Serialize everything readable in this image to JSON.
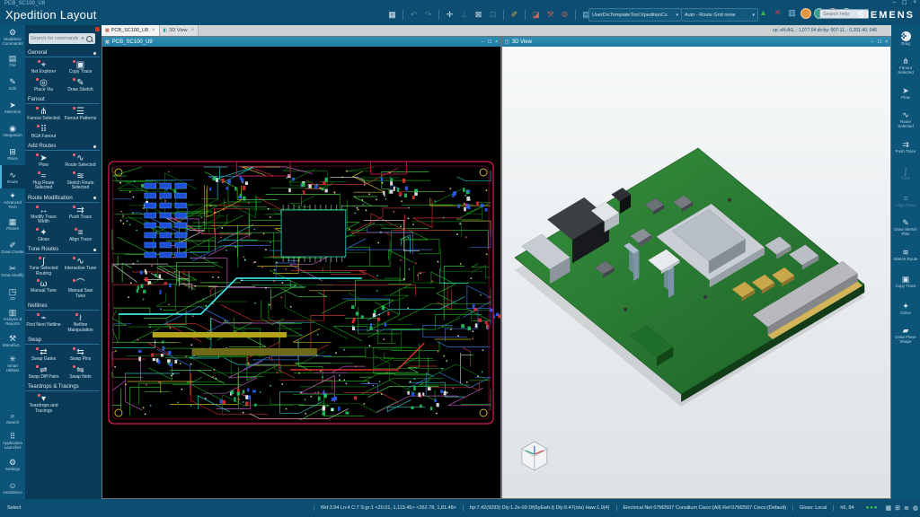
{
  "colors": {
    "titlebar_bg": "#0b4e71",
    "panel_bg": "#0a3c59",
    "window_titlebar": "#2786ad",
    "board_outline": "#d4145a",
    "board_green": "#2e8134",
    "canvas_bg": "#000000",
    "status_dot_green": "#39d353"
  },
  "titlebar": {
    "window_caption": "PCB_SC100_U8",
    "app_title": "Xpedition Layout",
    "brand": "SIEMENS",
    "search_placeholder": "Search help",
    "minimize_label": "–",
    "maximize_label": "☐",
    "close_label": "×"
  },
  "toolbar": {
    "dropdown_template": "UserDrcTemplateTool:XpeditionCs",
    "dropdown_route": "Auto - Route Grid none",
    "readout": "vp: eN:AG, : 1,077.04    drcby: 007-11, : 0,201.40,  046",
    "items": [
      {
        "name": "design-status-icon"
      },
      {
        "name": "separator"
      },
      {
        "name": "undo-icon",
        "disabled": true
      },
      {
        "name": "redo-icon",
        "disabled": true
      },
      {
        "name": "separator"
      },
      {
        "name": "pin-icon"
      },
      {
        "name": "align-icon",
        "disabled": true
      },
      {
        "name": "lock-icon"
      },
      {
        "name": "unlock-icon",
        "disabled": true
      },
      {
        "name": "separator"
      },
      {
        "name": "measure-icon",
        "accent": "#e8a33d"
      },
      {
        "name": "separator"
      },
      {
        "name": "eraser-icon",
        "accent": "#c56a5a"
      },
      {
        "name": "hammer-icon",
        "accent": "#b85c4e"
      },
      {
        "name": "wrench-icon",
        "accent": "#b85c4e"
      },
      {
        "name": "separator"
      },
      {
        "name": "scheme-icon",
        "accent": "#8fc3dd"
      }
    ],
    "right_items": [
      {
        "name": "check-icon",
        "accent": "#3fae5a"
      },
      {
        "name": "cross-icon",
        "accent": "#c74040"
      },
      {
        "name": "report-icon",
        "accent": "#8fc3dd"
      }
    ],
    "circles": [
      {
        "name": "status-orange-icon",
        "color": "#e2973f"
      },
      {
        "name": "status-teal-icon",
        "color": "#2f9f8f"
      },
      {
        "name": "status-red-icon",
        "color": "#c74040"
      },
      {
        "name": "status-green-icon",
        "color": "#3fae5a"
      }
    ]
  },
  "tabs": [
    {
      "label": "PCB_SC100_U8",
      "active": true,
      "icon": "pcb-tab-icon"
    },
    {
      "label": "3D View",
      "active": false,
      "icon": "cube-tab-icon"
    }
  ],
  "left_rail": {
    "items": [
      {
        "label": "Modeless Commands",
        "icon": "modeless-commands-icon"
      },
      {
        "label": "File",
        "icon": "file-icon"
      },
      {
        "label": "Edit",
        "icon": "edit-icon"
      },
      {
        "label": "Selection",
        "icon": "selection-icon"
      },
      {
        "label": "Integration",
        "icon": "integration-icon"
      },
      {
        "label": "Place",
        "icon": "place-icon"
      },
      {
        "label": "Route",
        "icon": "route-icon",
        "selected": true
      },
      {
        "label": "Advanced Tech",
        "icon": "advanced-tech-icon"
      },
      {
        "label": "Planes",
        "icon": "planes-icon"
      },
      {
        "label": "Draw Create",
        "icon": "draw-create-icon"
      },
      {
        "label": "Draw Modify",
        "icon": "draw-modify-icon"
      },
      {
        "label": "3D",
        "icon": "3d-icon"
      },
      {
        "label": "Analysis & Reports",
        "icon": "analysis-reports-icon"
      },
      {
        "label": "Manufact...",
        "icon": "manufacturing-icon"
      },
      {
        "label": "Smart Utilities",
        "icon": "smart-utilities-icon"
      }
    ],
    "bottom_items": [
      {
        "label": "Search",
        "icon": "search-icon"
      },
      {
        "label": "Application Launcher",
        "icon": "application-launcher-icon"
      },
      {
        "label": "Settings",
        "icon": "settings-icon"
      },
      {
        "label": "Assistance",
        "icon": "assistance-icon"
      }
    ]
  },
  "panel": {
    "search_placeholder": "Search for commands",
    "sections": [
      {
        "title": "General",
        "pinned": true,
        "items": [
          {
            "label": "Net Explorer",
            "icon": "net-explorer-icon"
          },
          {
            "label": "Copy Trace",
            "icon": "copy-trace-icon"
          },
          {
            "label": "Place Via",
            "icon": "place-via-icon"
          },
          {
            "label": "Draw Sketch",
            "icon": "draw-sketch-icon"
          }
        ]
      },
      {
        "title": "Fanout",
        "pinned": false,
        "items": [
          {
            "label": "Fanout Selected",
            "icon": "fanout-selected-icon"
          },
          {
            "label": "Fanout Patterns",
            "icon": "fanout-patterns-icon"
          },
          {
            "label": "BGA Fanout",
            "icon": "bga-fanout-icon"
          }
        ]
      },
      {
        "title": "Add Routes",
        "pinned": true,
        "items": [
          {
            "label": "Plow",
            "icon": "plow-icon"
          },
          {
            "label": "Route Selected",
            "icon": "route-selected-icon"
          },
          {
            "label": "Hug Route Selected",
            "icon": "hug-route-selected-icon"
          },
          {
            "label": "Sketch Route Selected",
            "icon": "sketch-route-selected-icon"
          }
        ]
      },
      {
        "title": "Route Modification",
        "pinned": true,
        "items": [
          {
            "label": "Modify Trace Width",
            "icon": "modify-trace-width-icon"
          },
          {
            "label": "Push Trace",
            "icon": "push-trace-icon"
          },
          {
            "label": "Gloss",
            "icon": "gloss-icon"
          },
          {
            "label": "Align Trace",
            "icon": "align-trace-icon"
          }
        ]
      },
      {
        "title": "Tune Routes",
        "pinned": true,
        "items": [
          {
            "label": "Tune Selected Routing",
            "icon": "tune-selected-routing-icon"
          },
          {
            "label": "Interactive Tune",
            "icon": "interactive-tune-icon"
          },
          {
            "label": "Manual Tune",
            "icon": "manual-tune-icon"
          },
          {
            "label": "Manual Saw Tune",
            "icon": "manual-saw-tune-icon"
          }
        ]
      },
      {
        "title": "Netlines",
        "pinned": false,
        "items": [
          {
            "label": "Find Next Netline",
            "icon": "find-next-netline-icon"
          },
          {
            "label": "Netline Manipulation",
            "icon": "netline-manipulation-icon"
          }
        ]
      },
      {
        "title": "Swap",
        "pinned": false,
        "items": [
          {
            "label": "Swap Gates",
            "icon": "swap-gates-icon"
          },
          {
            "label": "Swap Pins",
            "icon": "swap-pins-icon"
          },
          {
            "label": "Swap Diff Pairs",
            "icon": "swap-diff-pairs-icon"
          },
          {
            "label": "Swap Nets",
            "icon": "swap-nets-icon"
          }
        ]
      },
      {
        "title": "Teardrops & Tracings",
        "pinned": false,
        "items": [
          {
            "label": "Teardrops and Tracings",
            "icon": "teardrops-icon"
          }
        ]
      }
    ]
  },
  "windows": {
    "pcb": {
      "title": "PCB_SC100_U8"
    },
    "view3d": {
      "title": "3D View"
    }
  },
  "right_rail": {
    "items": [
      {
        "label": "Drag",
        "icon": "drag-icon",
        "round": true
      },
      {
        "label": "Fanout Selected",
        "icon": "fanout-selected-icon"
      },
      {
        "label": "Plow",
        "icon": "plow-icon"
      },
      {
        "label": "Route Selected",
        "icon": "route-selected-icon"
      },
      {
        "label": "Push Trace",
        "icon": "push-trace-icon"
      },
      {
        "label": "Tune",
        "icon": "tune-icon",
        "disabled": true
      },
      {
        "label": "Align Trace",
        "icon": "align-trace-icon",
        "disabled": true
      },
      {
        "label": "Draw Sketch Plan",
        "icon": "draw-sketch-icon"
      },
      {
        "label": "Sketch Route",
        "icon": "sketch-route-icon"
      },
      {
        "label": "Copy Trace",
        "icon": "copy-trace-icon"
      },
      {
        "label": "Gloss",
        "icon": "gloss-icon"
      },
      {
        "label": "Draw Plane Shape",
        "icon": "draw-plane-shape-icon"
      }
    ]
  },
  "statusbar": {
    "mode": "Select",
    "segments": [
      "Wd:3.94 Ln:4 C:7 S:gr:1   <20.01, 1,119.45>   <262.78, 1,81.48>",
      "hp:7.42(9293) Dly:1.2e-09 Df(6yEwh.t) Dly:9.47(n/a) Haw:1.0(4)",
      "Electrical Net 07M2507 Consilium Cisco:(All) Ref:07M2507 Cisco:(Default)",
      "Gloss: Local",
      "h6, 84"
    ],
    "dots": 3,
    "icons": [
      {
        "name": "grid-icon"
      },
      {
        "name": "cells-icon"
      },
      {
        "name": "layers-icon"
      },
      {
        "name": "world-icon"
      }
    ]
  }
}
